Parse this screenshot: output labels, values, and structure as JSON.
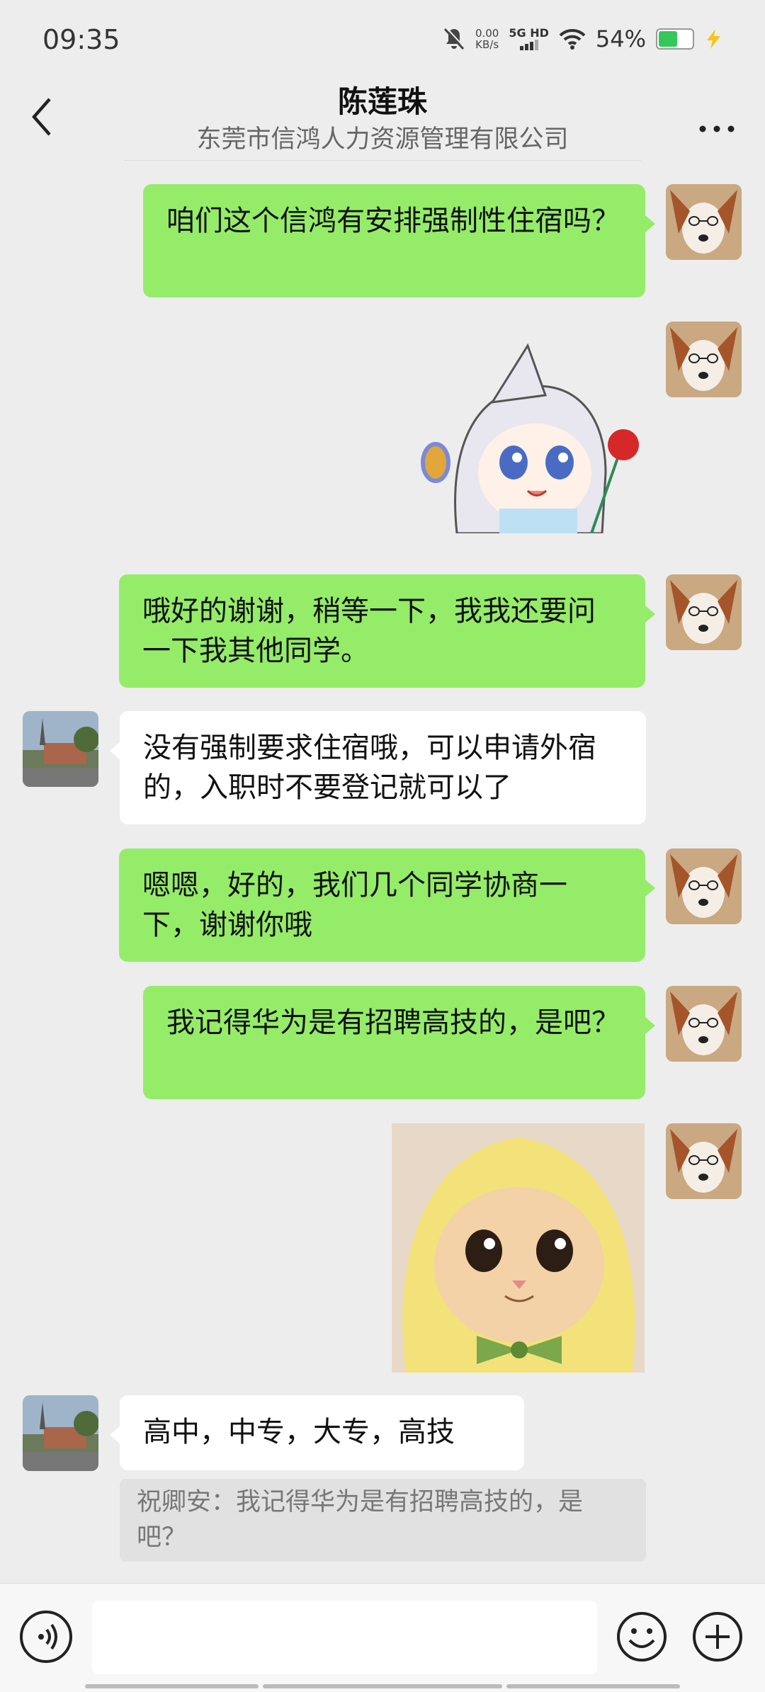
{
  "status_bar": {
    "time": "09:35",
    "speed": "0.00",
    "speed_unit": "KB/s",
    "network": "5G HD",
    "battery": "54%"
  },
  "header": {
    "title": "陈莲珠",
    "subtitle": "东莞市信鸿人力资源管理有限公司"
  },
  "messages": [
    {
      "from": "me",
      "type": "text",
      "text": "咱们这个信鸿有安排强制性住宿吗？"
    },
    {
      "from": "me",
      "type": "sticker",
      "icon": "anime-girl-rose-sticker"
    },
    {
      "from": "me",
      "type": "text",
      "text": "哦好的谢谢，稍等一下，我我还要问一下我其他同学。"
    },
    {
      "from": "other",
      "type": "text",
      "text": "没有强制要求住宿哦，可以申请外宿的，入职时不要登记就可以了"
    },
    {
      "from": "me",
      "type": "text",
      "text": "嗯嗯，好的，我们几个同学协商一下，谢谢你哦"
    },
    {
      "from": "me",
      "type": "text",
      "text": "我记得华为是有招聘高技的，是吧？"
    },
    {
      "from": "me",
      "type": "sticker",
      "icon": "cat-in-banana-hat-sticker"
    },
    {
      "from": "other",
      "type": "text",
      "text": "高中，中专，大专，高技",
      "quote": "祝卿安：我记得华为是有招聘高技的，是吧？"
    }
  ],
  "colors": {
    "background": "#ededed",
    "my_bubble": "#95ec69",
    "other_bubble": "#ffffff",
    "bottom_bar": "#f7f7f7"
  },
  "icons": {
    "back": "chevron-left-icon",
    "more": "more-dots-icon",
    "voice": "voice-icon",
    "emoji": "smiley-icon",
    "plus": "plus-icon"
  }
}
